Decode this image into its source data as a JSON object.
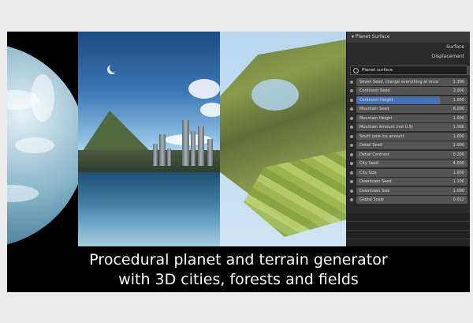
{
  "caption": {
    "line1": "Procedural planet and terrain generator",
    "line2": "with 3D cities, forests and fields"
  },
  "panel": {
    "header": "Planet Surface",
    "surface_label": "Surface",
    "displacement_label": "Displacement",
    "node_name": "Planet surface",
    "params": [
      {
        "label": "Seven Seed, change everything at once",
        "value": "1.300"
      },
      {
        "label": "Continent Seed",
        "value": "3.000"
      },
      {
        "label": "Continent Height",
        "value": "1.000"
      },
      {
        "label": "Mountain Seed",
        "value": "8.000"
      },
      {
        "label": "Mountain Height",
        "value": "1.000"
      },
      {
        "label": "Mountain Amount (not 0.5)",
        "value": "1.000"
      },
      {
        "label": "South pole ice amount",
        "value": "1.000"
      },
      {
        "label": "Detail Seed",
        "value": "1.000"
      },
      {
        "label": "Detail Contrast",
        "value": "0.200"
      },
      {
        "label": "City Seed",
        "value": "4.000"
      },
      {
        "label": "City Size",
        "value": "1.000"
      },
      {
        "label": "Downtown Seed",
        "value": "1.100"
      },
      {
        "label": "Downtown Size",
        "value": "1.000"
      },
      {
        "label": "Global Scale",
        "value": "0.012"
      }
    ]
  }
}
